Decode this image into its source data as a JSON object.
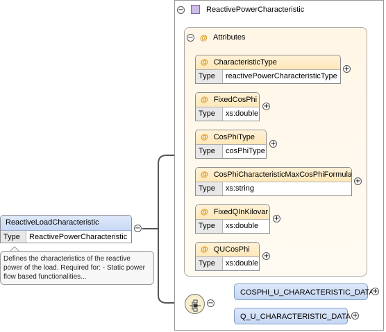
{
  "complex_type": {
    "collapse_symbol": "−",
    "name": "ReactivePowerCharacteristic"
  },
  "attributes_group": {
    "collapse_symbol": "−",
    "at_symbol": "@",
    "label": "Attributes"
  },
  "attributes": [
    {
      "name": "CharacteristicType",
      "type_label": "Type",
      "type": "reactivePowerCharacteristicType",
      "expand_symbol": "+"
    },
    {
      "name": "FixedCosPhi",
      "type_label": "Type",
      "type": "xs:double",
      "expand_symbol": "+"
    },
    {
      "name": "CosPhiType",
      "type_label": "Type",
      "type": "cosPhiType",
      "expand_symbol": "+"
    },
    {
      "name": "CosPhiCharacteristicMaxCosPhiFormula",
      "type_label": "Type",
      "type": "xs:string",
      "expand_symbol": "+"
    },
    {
      "name": "FixedQInKilovar",
      "type_label": "Type",
      "type": "xs:double",
      "expand_symbol": "+"
    },
    {
      "name": "QUCosPhi",
      "type_label": "Type",
      "type": "xs:double",
      "expand_symbol": "+"
    }
  ],
  "element": {
    "name": "ReactiveLoadCharacteristic",
    "type_label": "Type",
    "type": "ReactivePowerCharacteristic",
    "collapse_symbol": "−",
    "documentation": "Defines the characteristics of the reactive power of the load. Required for: - Static power flow based functionalities..."
  },
  "choice": {
    "collapse_symbol": "−",
    "items": [
      {
        "name": "COSPHI_U_CHARACTERISTIC_DATA",
        "expand_symbol": "+"
      },
      {
        "name": "Q_U_CHARACTERISTIC_DATA",
        "expand_symbol": "+"
      }
    ]
  },
  "colors": {
    "attribute_header": "#ffe7b8",
    "element_header": "#c8d9f5",
    "complex_type_icon": "#cdbde8",
    "at_symbol": "#d08a00"
  }
}
